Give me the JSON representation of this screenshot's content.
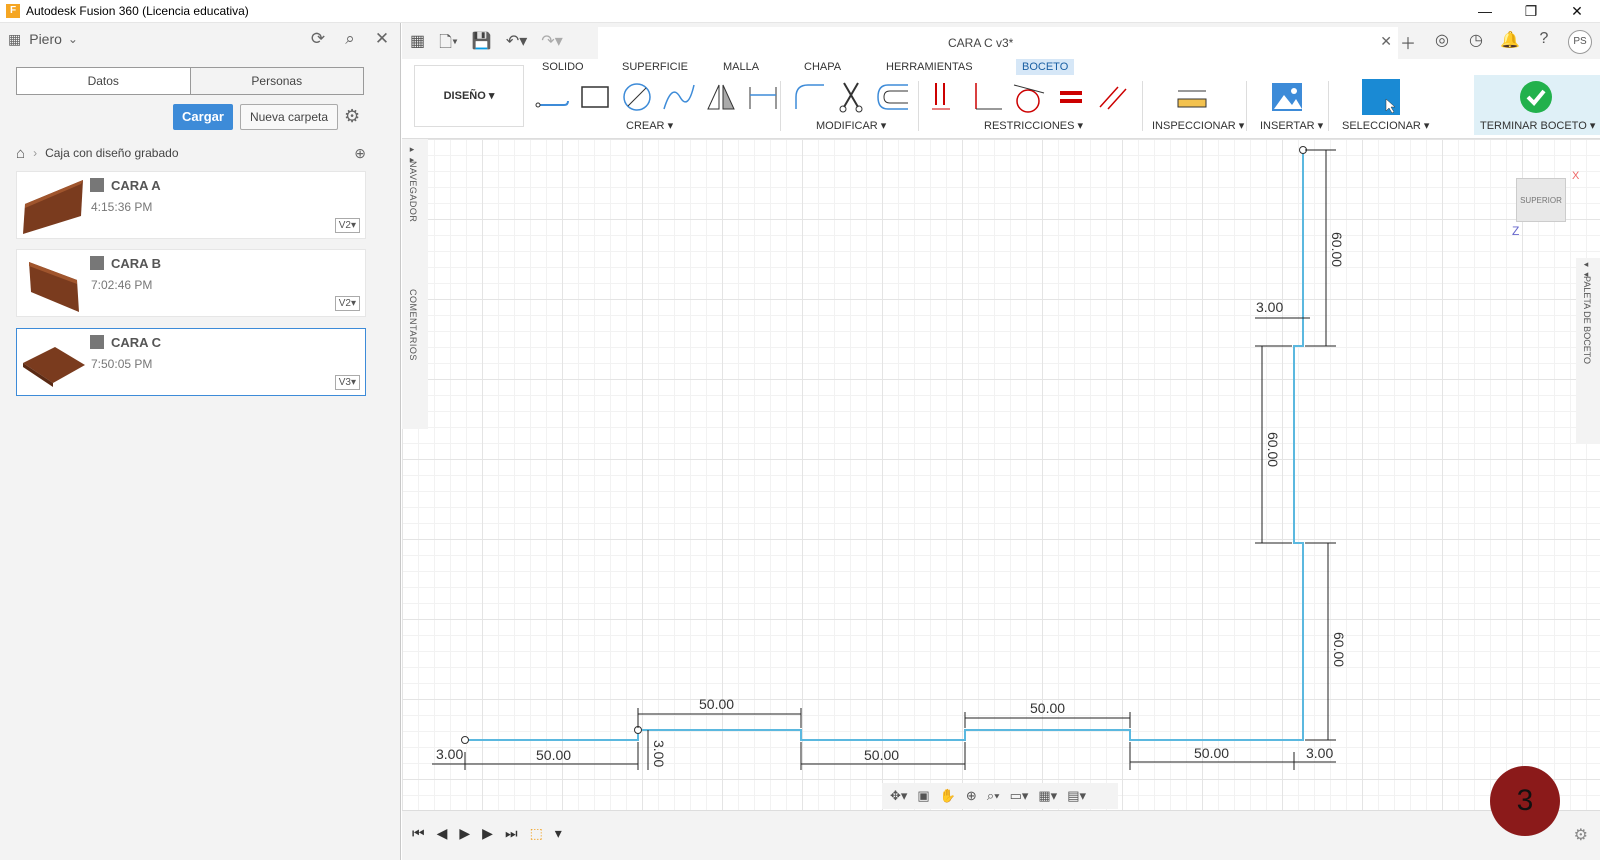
{
  "window": {
    "title": "Autodesk Fusion 360 (Licencia educativa)",
    "minimize": "—",
    "restore": "❐",
    "close": "✕"
  },
  "left_panel": {
    "user": "Piero",
    "tabs": [
      "Datos",
      "Personas"
    ],
    "upload_label": "Cargar",
    "new_folder_label": "Nueva carpeta",
    "breadcrumb": "Caja con diseño grabado",
    "files": [
      {
        "name": "CARA A",
        "time": "4:15:36 PM",
        "version": "V2"
      },
      {
        "name": "CARA B",
        "time": "7:02:46 PM",
        "version": "V2"
      },
      {
        "name": "CARA C",
        "time": "7:50:05 PM",
        "version": "V3"
      }
    ]
  },
  "document_tab": {
    "label": "CARA C v3*"
  },
  "user_initials": "PS",
  "ribbon": {
    "workspace": "DISEÑO",
    "tabs": [
      "SOLIDO",
      "SUPERFICIE",
      "MALLA",
      "CHAPA",
      "HERRAMIENTAS",
      "BOCETO"
    ],
    "active_tab": "BOCETO",
    "groups": [
      "CREAR",
      "MODIFICAR",
      "RESTRICCIONES",
      "INSPECCIONAR",
      "INSERTAR",
      "SELECCIONAR",
      "TERMINAR BOCETO"
    ]
  },
  "side_labels": {
    "navigator": "NAVEGADOR",
    "comments": "COMENTARIOS",
    "sketch_palette": "PALETA DE BOCETO"
  },
  "viewcube": {
    "face": "SUPERIOR",
    "x_axis": "X",
    "z_axis": "Z"
  },
  "dimensions": {
    "left_offset": "3.00",
    "bottom_segments": [
      "50.00",
      "50.00",
      "50.00"
    ],
    "top_tabs": [
      "50.00",
      "50.00"
    ],
    "tab_height": "3.00",
    "right_offset": "3.00",
    "right_segments": [
      "60.00",
      "60.00",
      "60.00"
    ],
    "right_tab_width": "3.00"
  },
  "badge": "3",
  "colors": {
    "sketch_line": "#5bb8df",
    "accent": "#3d8bd8",
    "badge": "#8b1a1a",
    "active_tab": "#d6e7f7"
  }
}
